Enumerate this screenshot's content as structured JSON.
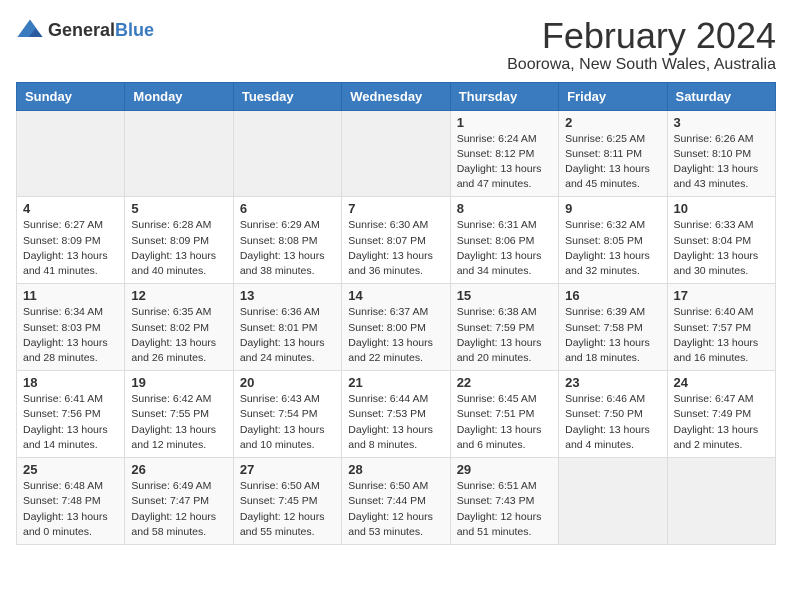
{
  "logo": {
    "general": "General",
    "blue": "Blue"
  },
  "title": "February 2024",
  "subtitle": "Boorowa, New South Wales, Australia",
  "days_of_week": [
    "Sunday",
    "Monday",
    "Tuesday",
    "Wednesday",
    "Thursday",
    "Friday",
    "Saturday"
  ],
  "weeks": [
    [
      {
        "day": "",
        "info": ""
      },
      {
        "day": "",
        "info": ""
      },
      {
        "day": "",
        "info": ""
      },
      {
        "day": "",
        "info": ""
      },
      {
        "day": "1",
        "info": "Sunrise: 6:24 AM\nSunset: 8:12 PM\nDaylight: 13 hours\nand 47 minutes."
      },
      {
        "day": "2",
        "info": "Sunrise: 6:25 AM\nSunset: 8:11 PM\nDaylight: 13 hours\nand 45 minutes."
      },
      {
        "day": "3",
        "info": "Sunrise: 6:26 AM\nSunset: 8:10 PM\nDaylight: 13 hours\nand 43 minutes."
      }
    ],
    [
      {
        "day": "4",
        "info": "Sunrise: 6:27 AM\nSunset: 8:09 PM\nDaylight: 13 hours\nand 41 minutes."
      },
      {
        "day": "5",
        "info": "Sunrise: 6:28 AM\nSunset: 8:09 PM\nDaylight: 13 hours\nand 40 minutes."
      },
      {
        "day": "6",
        "info": "Sunrise: 6:29 AM\nSunset: 8:08 PM\nDaylight: 13 hours\nand 38 minutes."
      },
      {
        "day": "7",
        "info": "Sunrise: 6:30 AM\nSunset: 8:07 PM\nDaylight: 13 hours\nand 36 minutes."
      },
      {
        "day": "8",
        "info": "Sunrise: 6:31 AM\nSunset: 8:06 PM\nDaylight: 13 hours\nand 34 minutes."
      },
      {
        "day": "9",
        "info": "Sunrise: 6:32 AM\nSunset: 8:05 PM\nDaylight: 13 hours\nand 32 minutes."
      },
      {
        "day": "10",
        "info": "Sunrise: 6:33 AM\nSunset: 8:04 PM\nDaylight: 13 hours\nand 30 minutes."
      }
    ],
    [
      {
        "day": "11",
        "info": "Sunrise: 6:34 AM\nSunset: 8:03 PM\nDaylight: 13 hours\nand 28 minutes."
      },
      {
        "day": "12",
        "info": "Sunrise: 6:35 AM\nSunset: 8:02 PM\nDaylight: 13 hours\nand 26 minutes."
      },
      {
        "day": "13",
        "info": "Sunrise: 6:36 AM\nSunset: 8:01 PM\nDaylight: 13 hours\nand 24 minutes."
      },
      {
        "day": "14",
        "info": "Sunrise: 6:37 AM\nSunset: 8:00 PM\nDaylight: 13 hours\nand 22 minutes."
      },
      {
        "day": "15",
        "info": "Sunrise: 6:38 AM\nSunset: 7:59 PM\nDaylight: 13 hours\nand 20 minutes."
      },
      {
        "day": "16",
        "info": "Sunrise: 6:39 AM\nSunset: 7:58 PM\nDaylight: 13 hours\nand 18 minutes."
      },
      {
        "day": "17",
        "info": "Sunrise: 6:40 AM\nSunset: 7:57 PM\nDaylight: 13 hours\nand 16 minutes."
      }
    ],
    [
      {
        "day": "18",
        "info": "Sunrise: 6:41 AM\nSunset: 7:56 PM\nDaylight: 13 hours\nand 14 minutes."
      },
      {
        "day": "19",
        "info": "Sunrise: 6:42 AM\nSunset: 7:55 PM\nDaylight: 13 hours\nand 12 minutes."
      },
      {
        "day": "20",
        "info": "Sunrise: 6:43 AM\nSunset: 7:54 PM\nDaylight: 13 hours\nand 10 minutes."
      },
      {
        "day": "21",
        "info": "Sunrise: 6:44 AM\nSunset: 7:53 PM\nDaylight: 13 hours\nand 8 minutes."
      },
      {
        "day": "22",
        "info": "Sunrise: 6:45 AM\nSunset: 7:51 PM\nDaylight: 13 hours\nand 6 minutes."
      },
      {
        "day": "23",
        "info": "Sunrise: 6:46 AM\nSunset: 7:50 PM\nDaylight: 13 hours\nand 4 minutes."
      },
      {
        "day": "24",
        "info": "Sunrise: 6:47 AM\nSunset: 7:49 PM\nDaylight: 13 hours\nand 2 minutes."
      }
    ],
    [
      {
        "day": "25",
        "info": "Sunrise: 6:48 AM\nSunset: 7:48 PM\nDaylight: 13 hours\nand 0 minutes."
      },
      {
        "day": "26",
        "info": "Sunrise: 6:49 AM\nSunset: 7:47 PM\nDaylight: 12 hours\nand 58 minutes."
      },
      {
        "day": "27",
        "info": "Sunrise: 6:50 AM\nSunset: 7:45 PM\nDaylight: 12 hours\nand 55 minutes."
      },
      {
        "day": "28",
        "info": "Sunrise: 6:50 AM\nSunset: 7:44 PM\nDaylight: 12 hours\nand 53 minutes."
      },
      {
        "day": "29",
        "info": "Sunrise: 6:51 AM\nSunset: 7:43 PM\nDaylight: 12 hours\nand 51 minutes."
      },
      {
        "day": "",
        "info": ""
      },
      {
        "day": "",
        "info": ""
      }
    ]
  ]
}
